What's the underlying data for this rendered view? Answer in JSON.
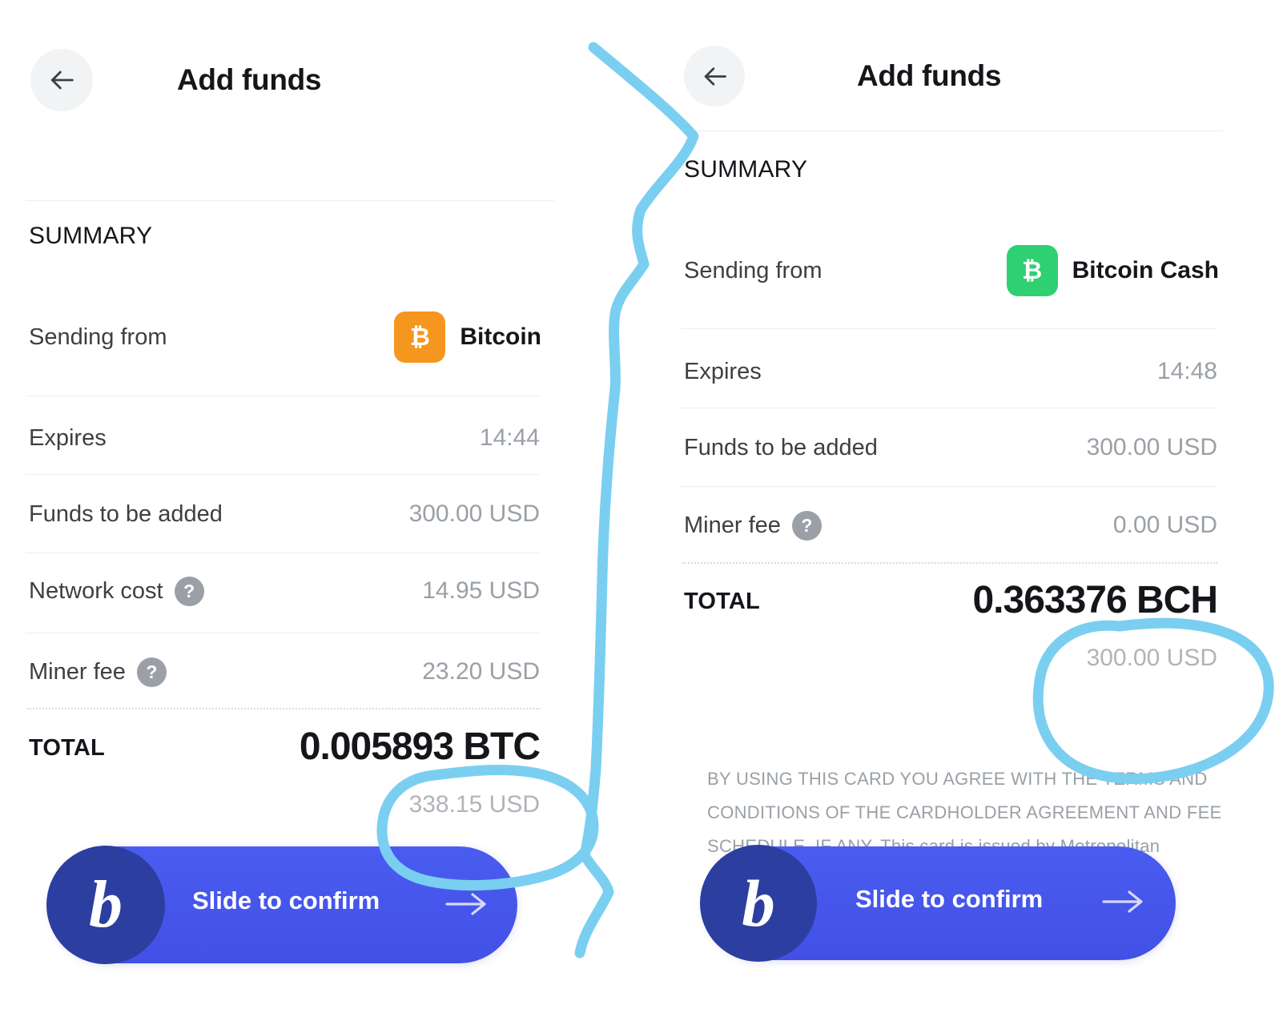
{
  "panels": [
    {
      "id": "bitcoin-panel",
      "header": {
        "title": "Add funds",
        "back_icon": "arrow-left-icon"
      },
      "summary_heading": "SUMMARY",
      "rows": [
        {
          "label": "Sending from",
          "type": "coin",
          "coin_name": "Bitcoin",
          "coin_symbol": "₿",
          "coin_color": "#F5971F"
        },
        {
          "label": "Expires",
          "type": "value",
          "value": "14:44"
        },
        {
          "label": "Funds to be added",
          "type": "value",
          "value": "300.00 USD"
        },
        {
          "label": "Network cost",
          "type": "value",
          "value": "14.95 USD",
          "help": "?"
        },
        {
          "label": "Miner fee",
          "type": "value",
          "value": "23.20 USD",
          "help": "?"
        }
      ],
      "total": {
        "label": "TOTAL",
        "crypto": "0.005893 BTC",
        "fiat": "338.15 USD"
      },
      "disclaimer": [],
      "slider": {
        "text": "Slide to confirm",
        "knob_glyph": "b",
        "arrow_icon": "arrow-right-icon"
      }
    },
    {
      "id": "bitcoin-cash-panel",
      "header": {
        "title": "Add funds",
        "back_icon": "arrow-left-icon"
      },
      "summary_heading": "SUMMARY",
      "rows": [
        {
          "label": "Sending from",
          "type": "coin",
          "coin_name": "Bitcoin Cash",
          "coin_symbol": "₿",
          "coin_color": "#2FD072"
        },
        {
          "label": "Expires",
          "type": "value",
          "value": "14:48"
        },
        {
          "label": "Funds to be added",
          "type": "value",
          "value": "300.00 USD"
        },
        {
          "label": "Miner fee",
          "type": "value",
          "value": "0.00 USD",
          "help": "?"
        }
      ],
      "total": {
        "label": "TOTAL",
        "crypto": "0.363376 BCH",
        "fiat": "300.00 USD"
      },
      "disclaimer": [
        "BY USING THIS CARD YOU AGREE WITH THE TERMS AND",
        "CONDITIONS OF THE CARDHOLDER AGREEMENT AND FEE",
        "SCHEDULE, IF ANY. This card is issued by Metropolitan"
      ],
      "slider": {
        "text": "Slide to confirm",
        "knob_glyph": "b",
        "arrow_icon": "arrow-right-icon"
      }
    }
  ],
  "annotations": {
    "ink_color": "#7ACFF0",
    "items": [
      {
        "name": "divider-squiggle",
        "kind": "line"
      },
      {
        "name": "circle-left-total-fiat",
        "kind": "circle",
        "targets": "338.15 USD"
      },
      {
        "name": "circle-right-total-fiat",
        "kind": "circle",
        "targets": "300.00 USD"
      }
    ]
  }
}
